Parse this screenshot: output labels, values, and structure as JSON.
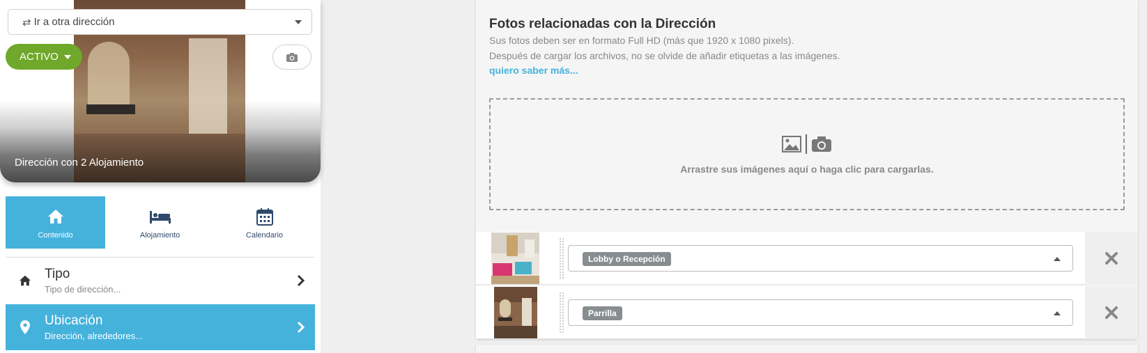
{
  "goto": {
    "label": "Ir a otra dirección",
    "icon": "swap-arrows-icon"
  },
  "status": {
    "label": "ACTIVO",
    "color": "#6fa82a"
  },
  "hero": {
    "caption": "Dirección con 2 Alojamiento"
  },
  "tabs": [
    {
      "label": "Contenido",
      "icon": "home-icon",
      "active": true
    },
    {
      "label": "Alojamiento",
      "icon": "bed-icon",
      "active": false
    },
    {
      "label": "Calendario",
      "icon": "calendar-icon",
      "active": false
    }
  ],
  "menu": [
    {
      "title": "Tipo",
      "subtitle": "Tipo de dirección...",
      "icon": "home-icon",
      "active": false
    },
    {
      "title": "Ubicación",
      "subtitle": "Dirección, alrededores...",
      "icon": "map-pin-icon",
      "active": true
    }
  ],
  "photos_section": {
    "title": "Fotos relacionadas con la Dirección",
    "line1": "Sus fotos deben ser en formato Full HD (más que 1920 x 1080 pixels).",
    "line2": "Después de cargar los archivos, no se olvide de añadir etiquetas a las imágenes.",
    "link": "quiero saber más...",
    "dropzone_text": "Arrastre sus imágenes aquí o haga clic para cargarlas.",
    "photos": [
      {
        "tag": "Lobby o Recepción"
      },
      {
        "tag": "Parrilla"
      }
    ]
  },
  "colors": {
    "accent": "#45b2dc",
    "active_green": "#6fa82a"
  }
}
